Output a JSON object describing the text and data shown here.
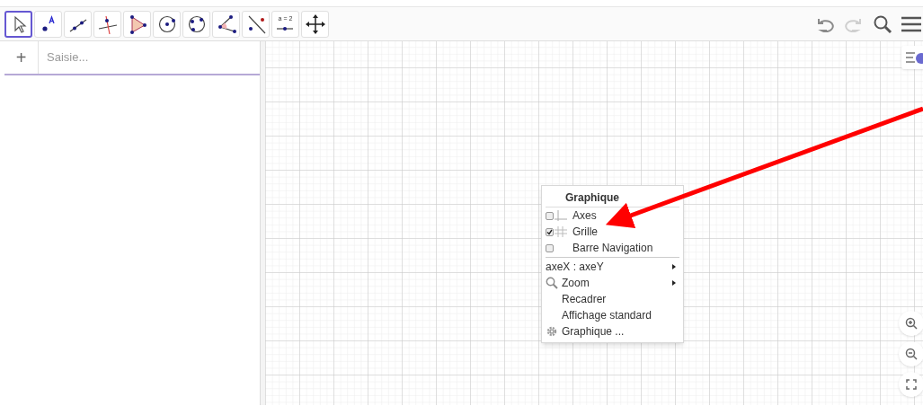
{
  "toolbar": {
    "tools": [
      {
        "kind": "move",
        "selected": true
      },
      {
        "kind": "point",
        "selected": false
      },
      {
        "kind": "line",
        "selected": false
      },
      {
        "kind": "perpendicular",
        "selected": false
      },
      {
        "kind": "polygon",
        "selected": false
      },
      {
        "kind": "circle",
        "selected": false
      },
      {
        "kind": "circle3",
        "selected": false
      },
      {
        "kind": "angle",
        "selected": false
      },
      {
        "kind": "reflect",
        "selected": false
      },
      {
        "kind": "slider",
        "selected": false,
        "label": "a = 2"
      },
      {
        "kind": "pan",
        "selected": false
      }
    ]
  },
  "algebra": {
    "add_label": "+",
    "input": {
      "placeholder": "Saisie..."
    }
  },
  "context_menu": {
    "items": [
      {
        "kind": "header",
        "label": "Graphique"
      },
      {
        "kind": "check",
        "label": "Axes",
        "checked": false
      },
      {
        "kind": "check",
        "label": "Grille",
        "checked": true
      },
      {
        "kind": "check",
        "label": "Barre Navigation",
        "checked": false
      },
      {
        "kind": "separator"
      },
      {
        "kind": "submenu",
        "label": "axeX : axeY"
      },
      {
        "kind": "submenu",
        "label": "Zoom"
      },
      {
        "kind": "action",
        "label": "Recadrer"
      },
      {
        "kind": "action",
        "label": "Affichage standard"
      },
      {
        "kind": "action",
        "label": "Graphique ..."
      }
    ]
  }
}
